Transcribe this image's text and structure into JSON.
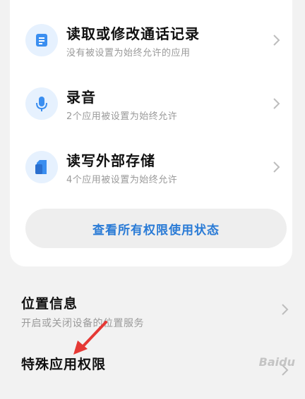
{
  "permissions": [
    {
      "title": "读取或修改通话记录",
      "subtitle": "没有被设置为始终允许的应用",
      "icon": "call-log-icon"
    },
    {
      "title": "录音",
      "subtitle": "2个应用被设置为始终允许",
      "icon": "microphone-icon"
    },
    {
      "title": "读写外部存储",
      "subtitle": "4个应用被设置为始终允许",
      "icon": "storage-icon"
    }
  ],
  "view_all_label": "查看所有权限使用状态",
  "settings": [
    {
      "title": "位置信息",
      "subtitle": "开启或关闭设备的位置服务"
    },
    {
      "title": "特殊应用权限",
      "subtitle": ""
    }
  ],
  "watermark": "Baidu",
  "colors": {
    "accent": "#2a7bd6",
    "icon_bg": "#e6f1fe",
    "arrow": "#e53935",
    "background": "#f2f2f2"
  }
}
